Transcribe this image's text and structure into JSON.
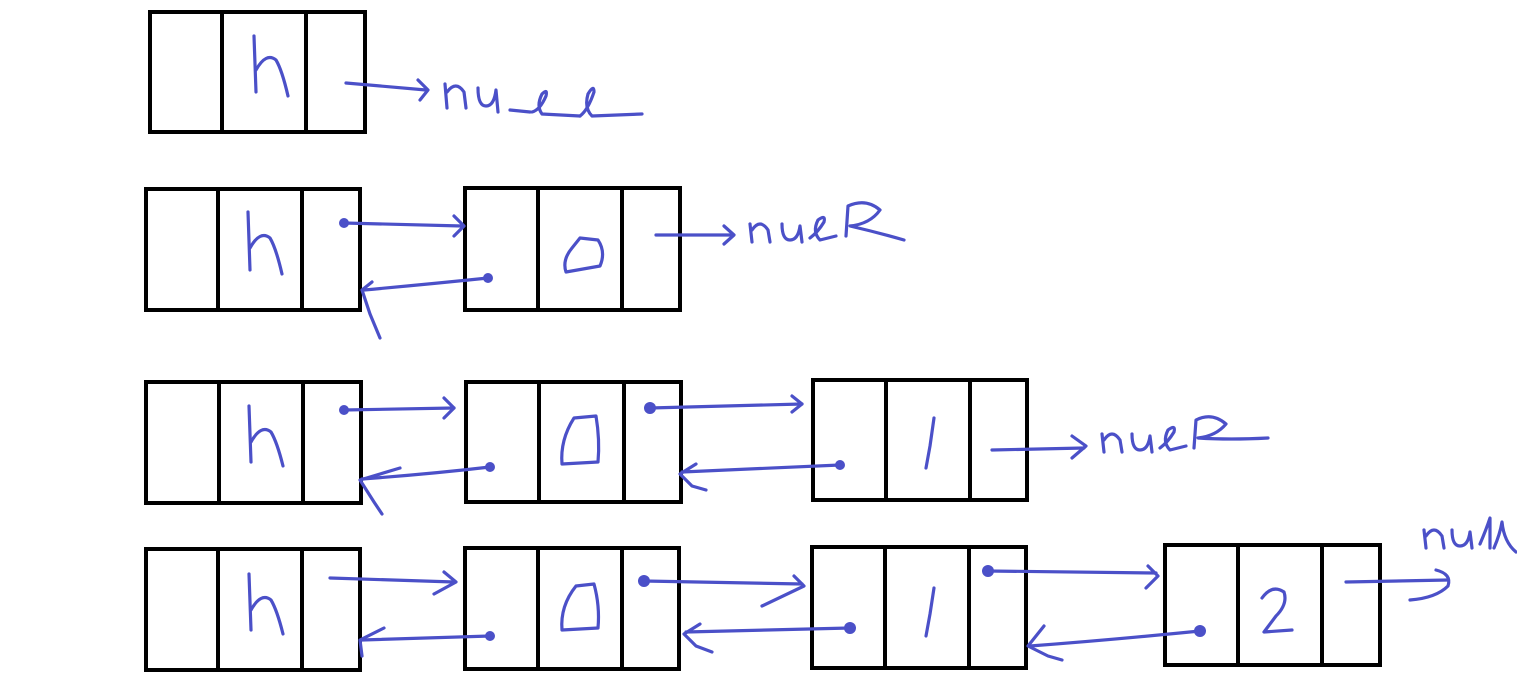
{
  "diagram": {
    "ink_color": "#4b50c8",
    "box_color": "#000000",
    "rows": [
      {
        "name": "row-1",
        "nodes": [
          {
            "value": "h"
          }
        ],
        "terminal": "null"
      },
      {
        "name": "row-2",
        "nodes": [
          {
            "value": "h"
          },
          {
            "value": "0"
          }
        ],
        "terminal": "null"
      },
      {
        "name": "row-3",
        "nodes": [
          {
            "value": "h"
          },
          {
            "value": "0"
          },
          {
            "value": "1"
          }
        ],
        "terminal": "null"
      },
      {
        "name": "row-4",
        "nodes": [
          {
            "value": "h"
          },
          {
            "value": "0"
          },
          {
            "value": "1"
          },
          {
            "value": "2"
          }
        ],
        "terminal": "null"
      }
    ]
  }
}
